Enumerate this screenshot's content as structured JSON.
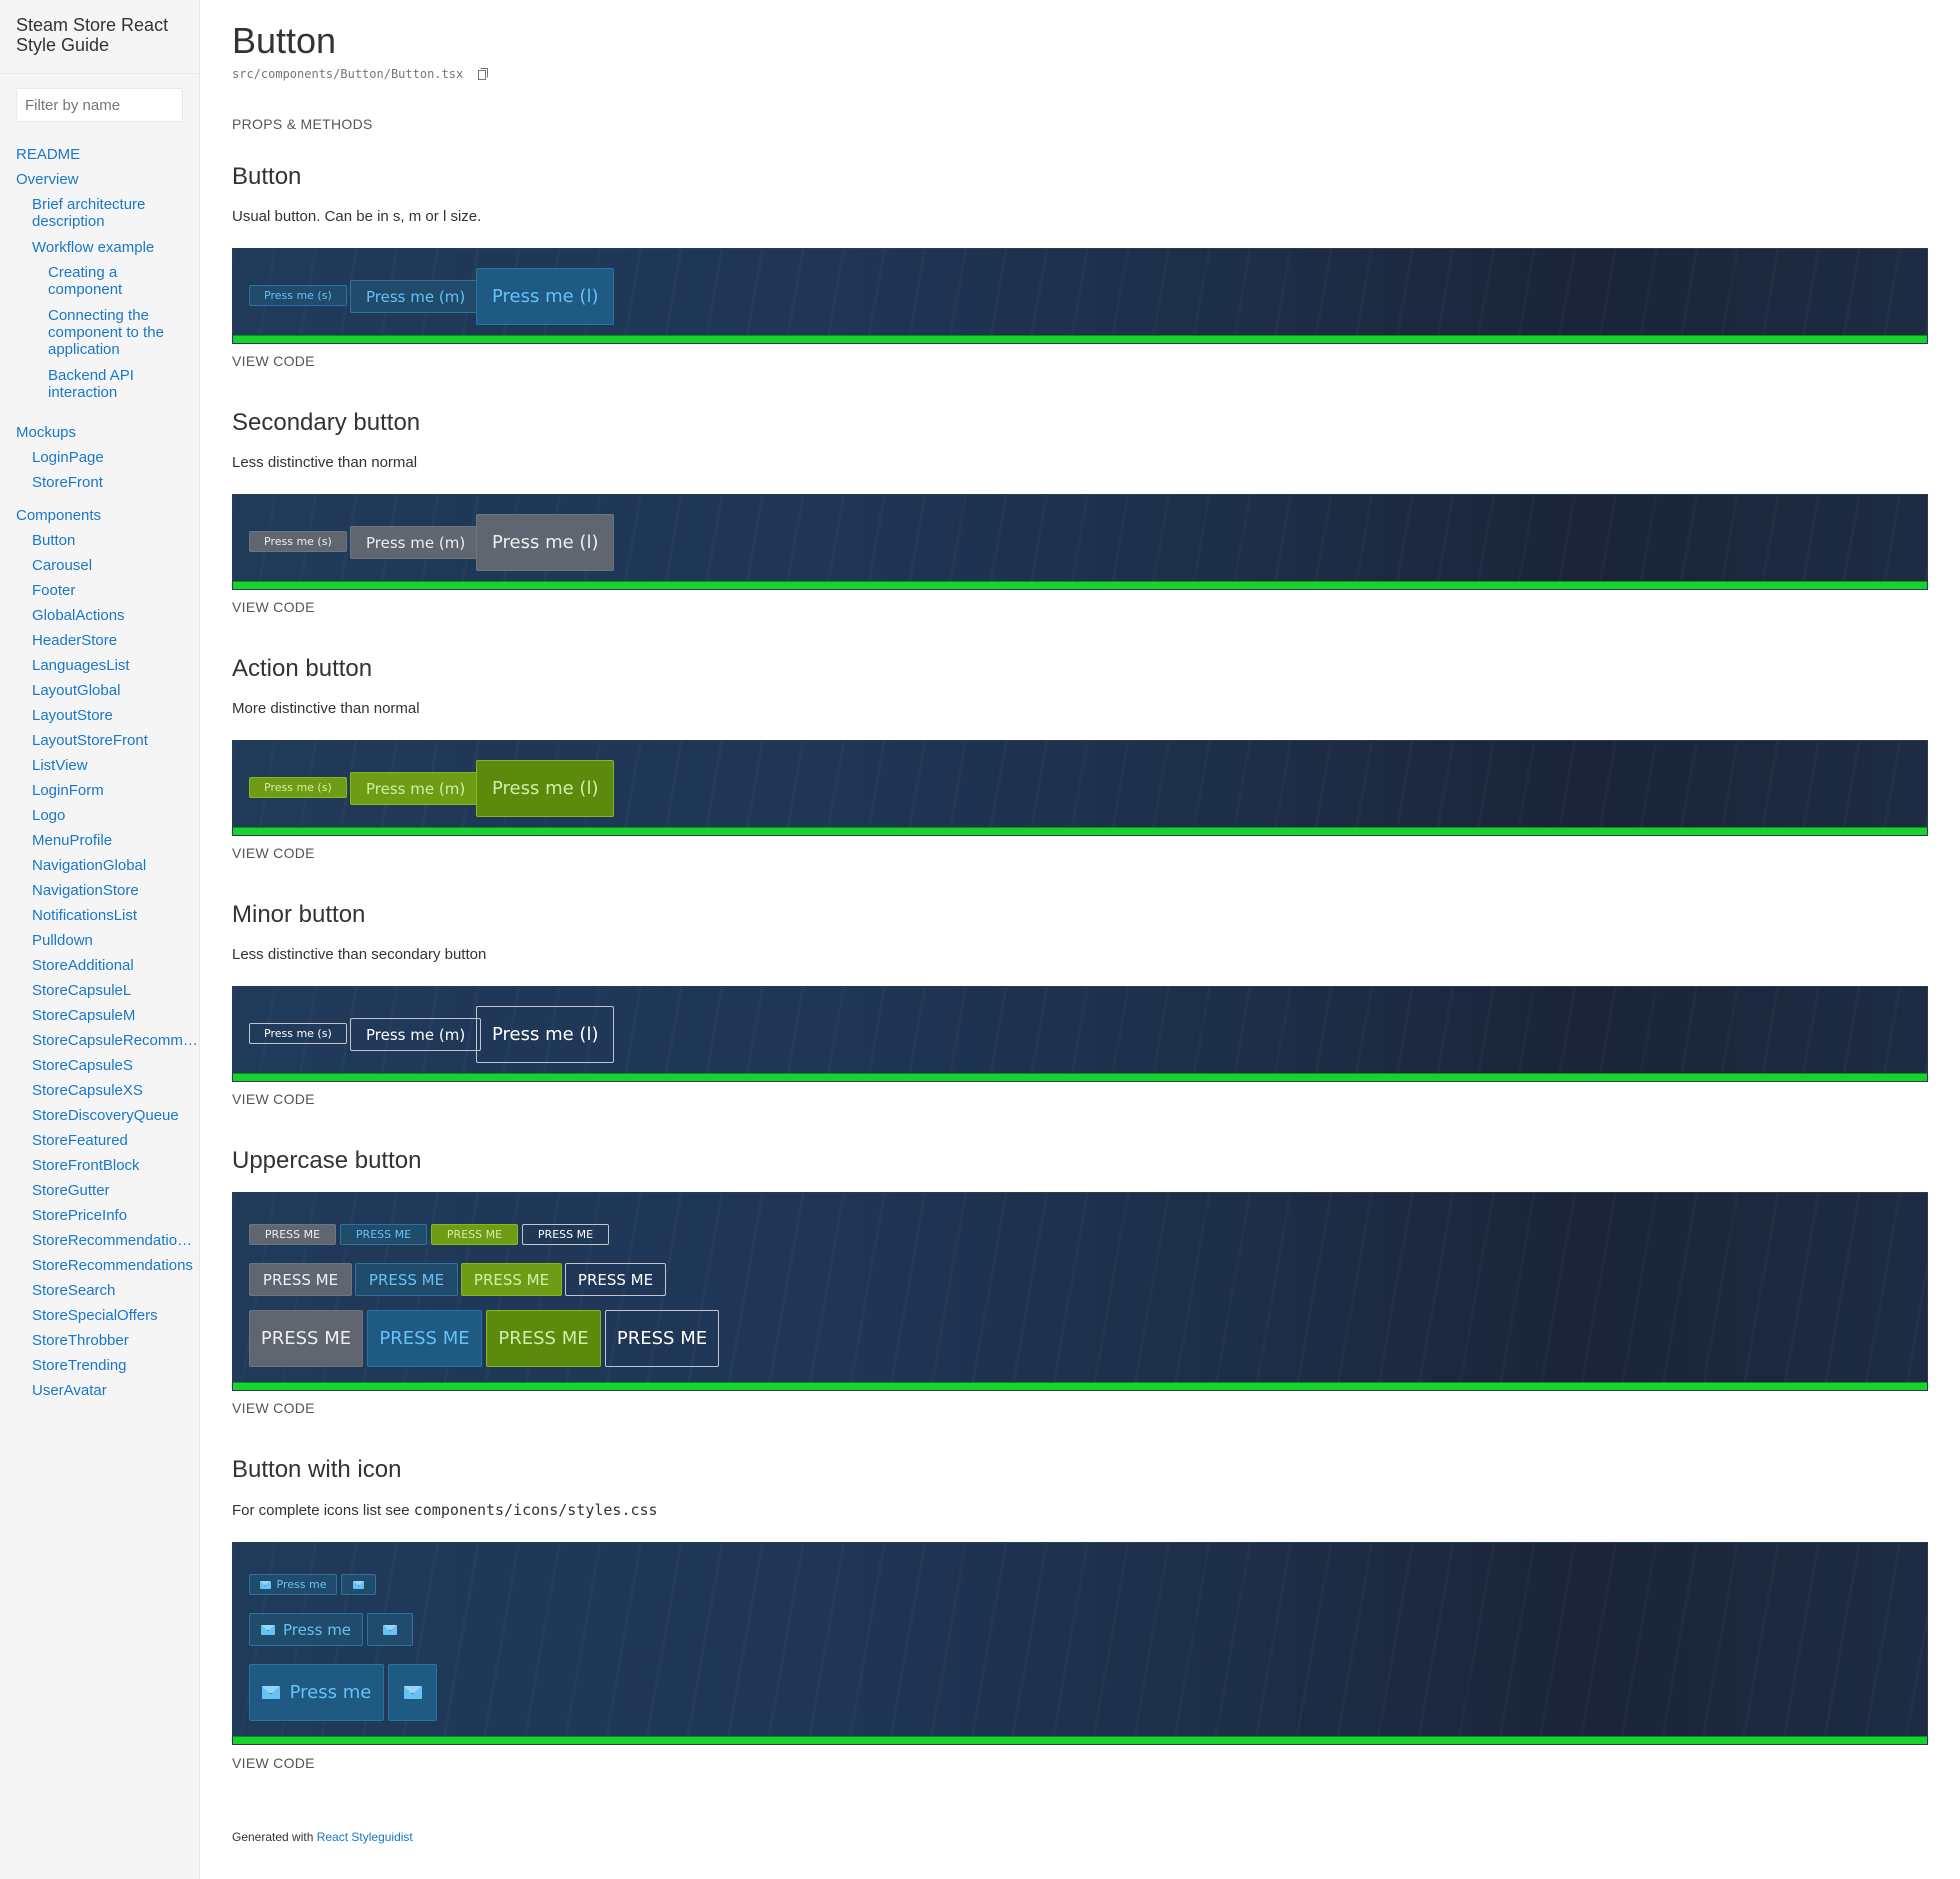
{
  "sidebar": {
    "brand": "Steam Store React Style Guide",
    "filter_placeholder": "Filter by name",
    "items": [
      {
        "label": "README"
      },
      {
        "label": "Overview"
      },
      {
        "label": "Brief architecture description"
      },
      {
        "label": "Workflow example"
      },
      {
        "label": "Creating a component"
      },
      {
        "label": "Connecting the component to the application"
      },
      {
        "label": "Backend API interaction"
      },
      {
        "label": "Mockups"
      },
      {
        "label": "LoginPage"
      },
      {
        "label": "StoreFront"
      },
      {
        "label": "Components"
      },
      {
        "label": "Button"
      },
      {
        "label": "Carousel"
      },
      {
        "label": "Footer"
      },
      {
        "label": "GlobalActions"
      },
      {
        "label": "HeaderStore"
      },
      {
        "label": "LanguagesList"
      },
      {
        "label": "LayoutGlobal"
      },
      {
        "label": "LayoutStore"
      },
      {
        "label": "LayoutStoreFront"
      },
      {
        "label": "ListView"
      },
      {
        "label": "LoginForm"
      },
      {
        "label": "Logo"
      },
      {
        "label": "MenuProfile"
      },
      {
        "label": "NavigationGlobal"
      },
      {
        "label": "NavigationStore"
      },
      {
        "label": "NotificationsList"
      },
      {
        "label": "Pulldown"
      },
      {
        "label": "StoreAdditional"
      },
      {
        "label": "StoreCapsuleL"
      },
      {
        "label": "StoreCapsuleM"
      },
      {
        "label": "StoreCapsuleRecommendation"
      },
      {
        "label": "StoreCapsuleS"
      },
      {
        "label": "StoreCapsuleXS"
      },
      {
        "label": "StoreDiscoveryQueue"
      },
      {
        "label": "StoreFeatured"
      },
      {
        "label": "StoreFrontBlock"
      },
      {
        "label": "StoreGutter"
      },
      {
        "label": "StorePriceInfo"
      },
      {
        "label": "StoreRecommendationBlock"
      },
      {
        "label": "StoreRecommendations"
      },
      {
        "label": "StoreSearch"
      },
      {
        "label": "StoreSpecialOffers"
      },
      {
        "label": "StoreThrobber"
      },
      {
        "label": "StoreTrending"
      },
      {
        "label": "UserAvatar"
      }
    ]
  },
  "main": {
    "title": "Button",
    "path": "src/components/Button/Button.tsx",
    "props_link": "PROPS & METHODS",
    "view_code": "VIEW CODE",
    "sections": [
      {
        "title": "Button",
        "desc": "Usual button. Can be in s, m or l size."
      },
      {
        "title": "Secondary button",
        "desc": "Less distinctive than normal"
      },
      {
        "title": "Action button",
        "desc": "More distinctive than normal"
      },
      {
        "title": "Minor button",
        "desc": "Less distinctive than secondary button"
      },
      {
        "title": "Uppercase button",
        "desc": ""
      },
      {
        "title": "Button with icon",
        "desc_prefix": "For complete icons list see ",
        "desc_code": "components/icons/styles.css"
      }
    ],
    "buttons": {
      "s": "Press me (s)",
      "m": "Press me (m)",
      "l": "Press me (l)",
      "upper": "Press me",
      "icon": "Press me"
    }
  },
  "footer": {
    "prefix": "Generated with ",
    "link": "React Styleguidist"
  },
  "colors": {
    "link": "#1978c8",
    "primary_text": "#67c1f5",
    "action_bg": "#6f9c15",
    "preview_bar": "#17d42c"
  }
}
